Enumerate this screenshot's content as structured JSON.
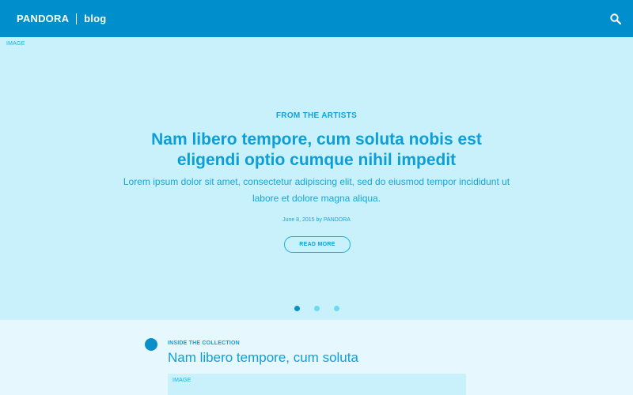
{
  "header": {
    "brand": "PANDORA",
    "section": "blog",
    "search_icon": "search-icon"
  },
  "hero": {
    "image_label": "IMAGE",
    "eyebrow": "FROM THE ARTISTS",
    "title": "Nam libero tempore, cum soluta nobis est eligendi optio cumque nihil impedit",
    "subtitle": "Lorem ipsum dolor sit amet, consectetur adipiscing elit, sed do eiusmod tempor incididunt ut labore et dolore magna aliqua.",
    "meta": "June 8, 2015 by PANDORA",
    "cta": "READ MORE",
    "slides": {
      "count": 3,
      "active_index": 0
    }
  },
  "article": {
    "eyebrow": "INSIDE THE COLLECTION",
    "title": "Nam libero tempore, cum soluta",
    "image_label": "IMAGE"
  },
  "colors": {
    "header_bg": "#008fcc",
    "hero_bg": "#c8f1fb",
    "page_bg": "#e6f7fd",
    "accent_text": "#0e9fd9",
    "dot_active": "#0a8fcb",
    "dot_inactive": "#6fd8f4"
  }
}
